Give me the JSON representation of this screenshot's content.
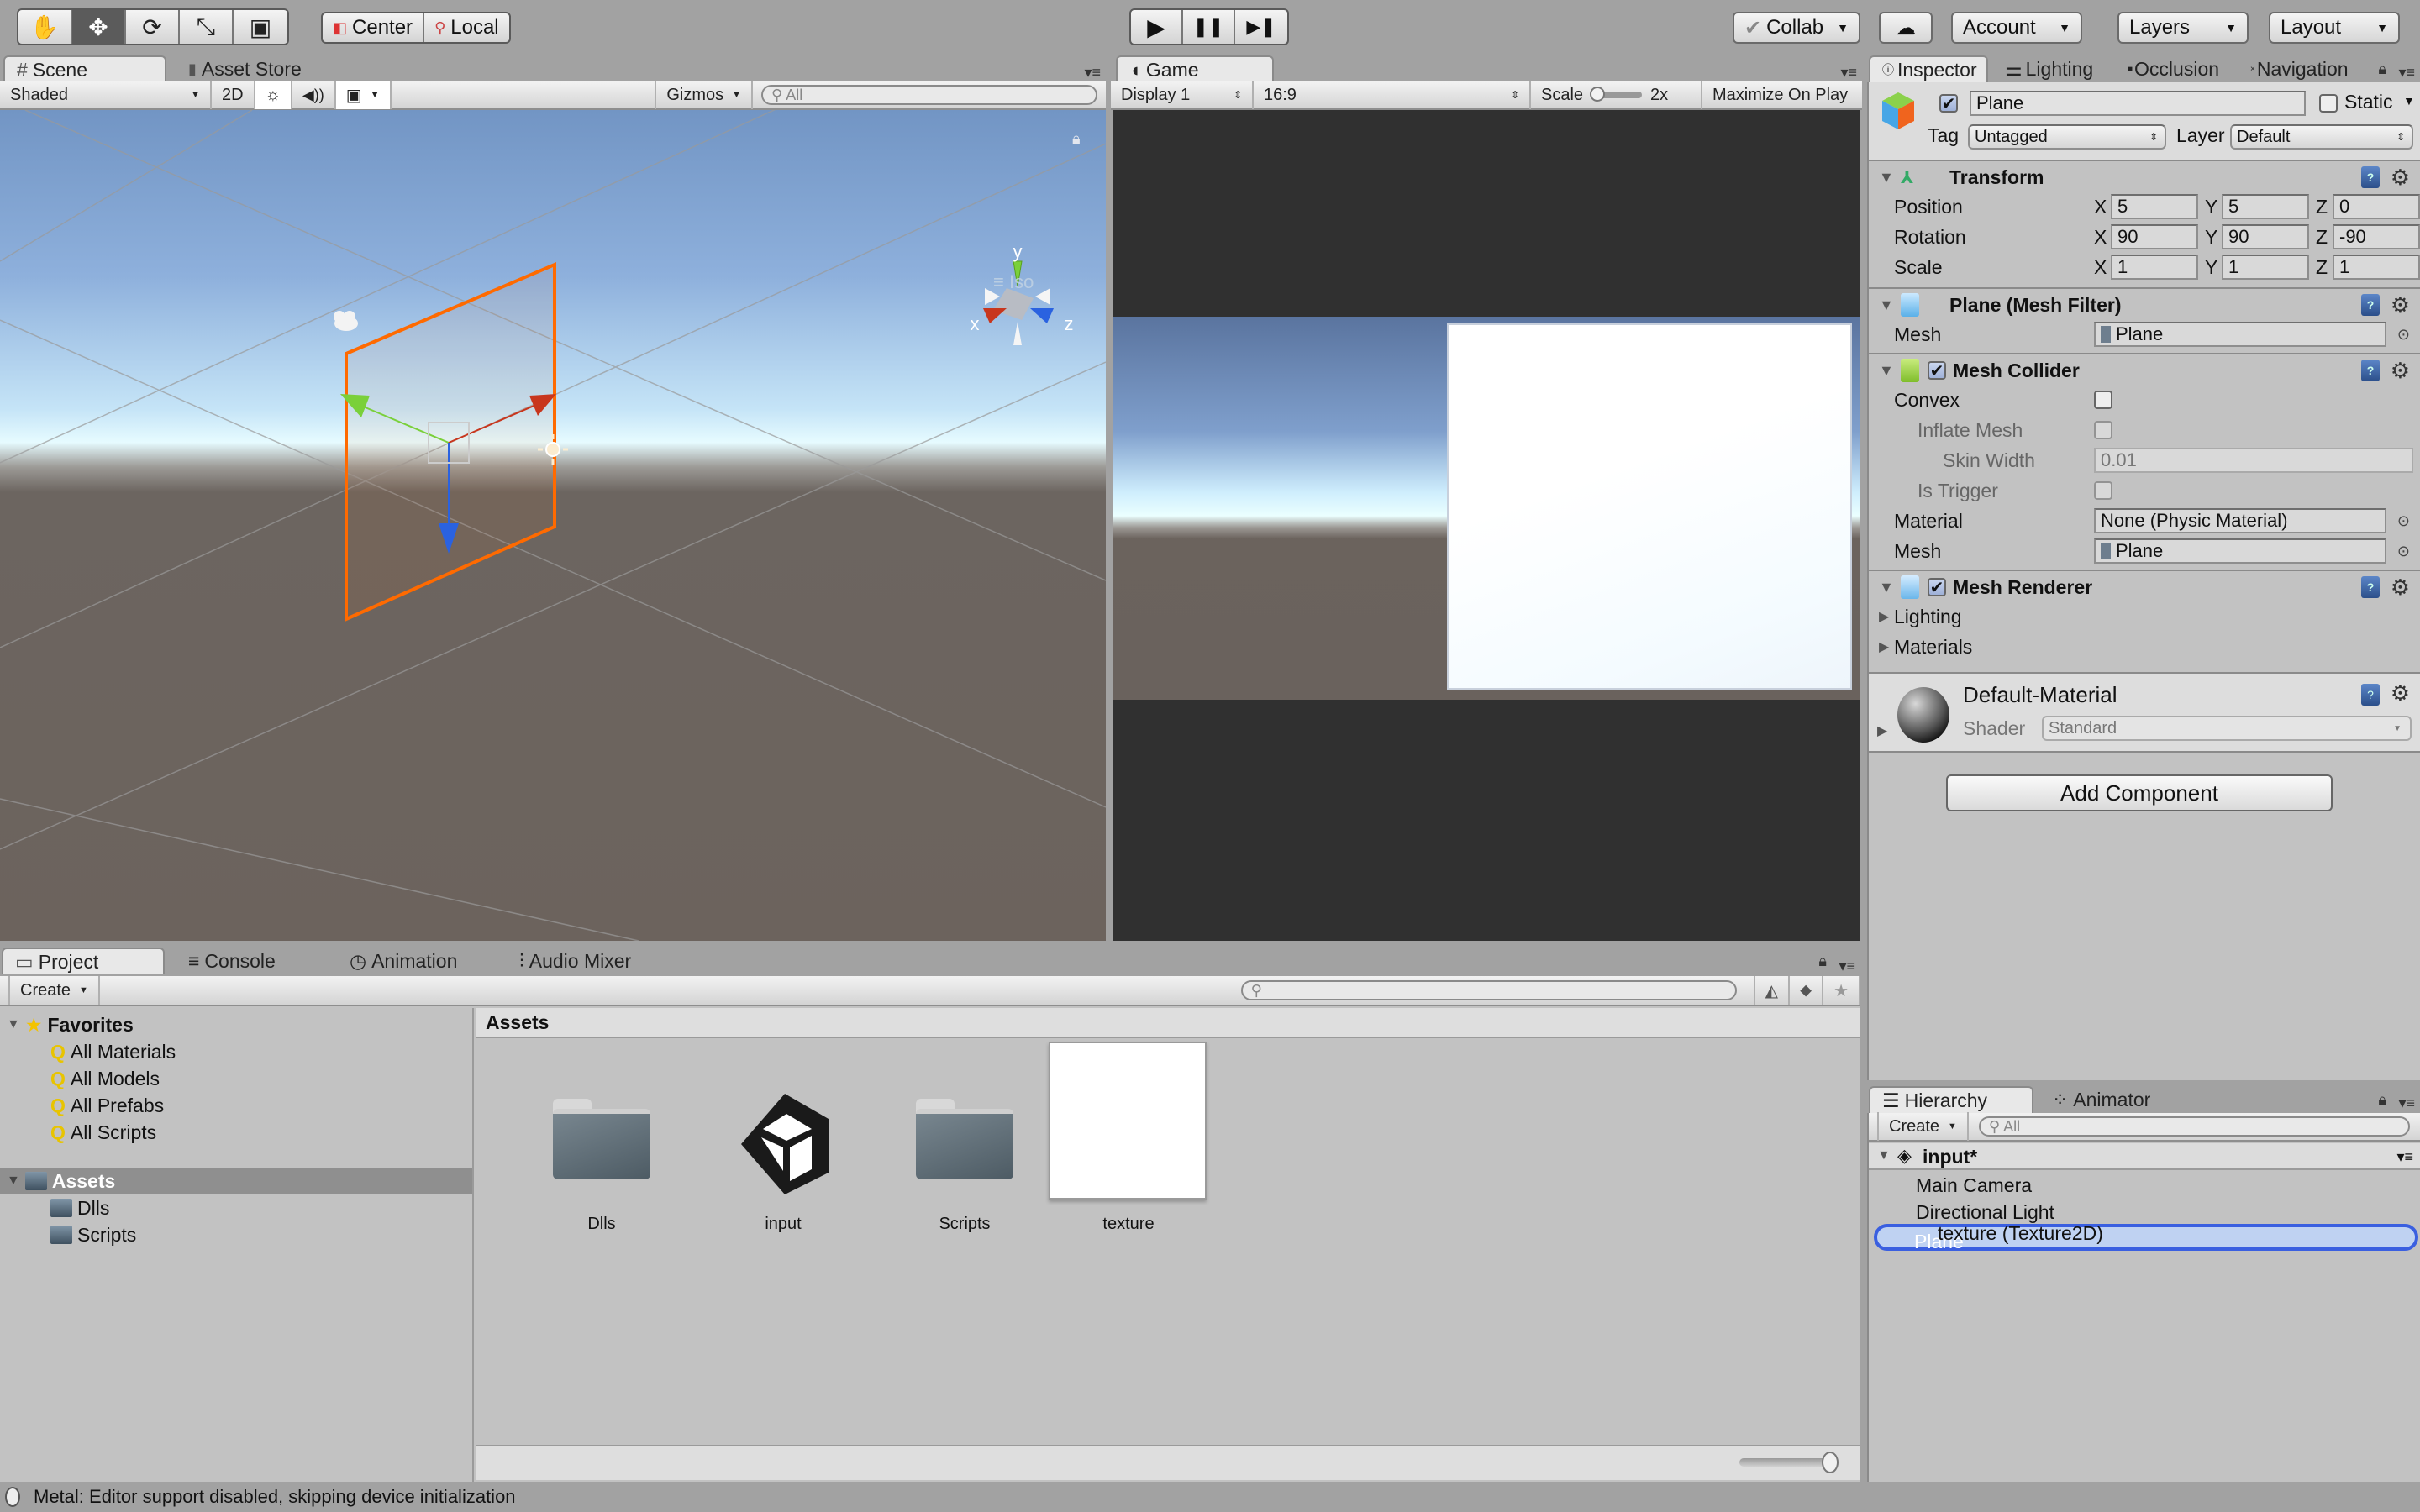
{
  "toolbar": {
    "transform_tools": [
      {
        "name": "hand-tool",
        "icon": "hand-icon",
        "glyph": "✋",
        "active": false
      },
      {
        "name": "move-tool",
        "icon": "move-arrows-icon",
        "glyph": "✥",
        "active": true
      },
      {
        "name": "rotate-tool",
        "icon": "rotate-icon",
        "glyph": "⟳",
        "active": false
      },
      {
        "name": "scale-tool",
        "icon": "scale-icon",
        "glyph": "⤡",
        "active": false
      },
      {
        "name": "rect-tool",
        "icon": "rect-transform-icon",
        "glyph": "▣",
        "active": false
      }
    ],
    "pivot_mode": "Center",
    "pivot_rotation": "Local",
    "play_glyphs": [
      "▶",
      "❚❚",
      "▶❚"
    ],
    "collab": "Collab",
    "cloud_glyph": "☁",
    "account": "Account",
    "layers": "Layers",
    "layout": "Layout"
  },
  "scene_panel": {
    "tabs": [
      {
        "label": "Scene",
        "glyph": "#",
        "active": true
      },
      {
        "label": "Asset Store",
        "glyph": "🛍",
        "active": false
      }
    ],
    "draw_mode": "Shaded",
    "mode_2d": "2D",
    "lighting_glyph": "☼",
    "audio_glyph": "🔊",
    "effects_glyph": "▣",
    "gizmos": "Gizmos",
    "search_placeholder": "All",
    "gizmo_axes": {
      "x": "x",
      "y": "y",
      "z": "z"
    },
    "projection": "Iso"
  },
  "game_panel": {
    "tab": "Game",
    "display": "Display 1",
    "aspect": "16:9",
    "scale_label": "Scale",
    "scale_value": "2x",
    "maximize": "Maximize On Play"
  },
  "inspector": {
    "tabs": [
      {
        "label": "Inspector",
        "active": true
      },
      {
        "label": "Lighting",
        "active": false
      },
      {
        "label": "Occlusion",
        "active": false
      },
      {
        "label": "Navigation",
        "active": false
      }
    ],
    "object_name": "Plane",
    "active": true,
    "static_label": "Static",
    "static": false,
    "tag_label": "Tag",
    "tag": "Untagged",
    "layer_label": "Layer",
    "layer": "Default",
    "transform": {
      "title": "Transform",
      "rows": [
        {
          "label": "Position",
          "x": "5",
          "y": "5",
          "z": "0"
        },
        {
          "label": "Rotation",
          "x": "90",
          "y": "90",
          "z": "-90"
        },
        {
          "label": "Scale",
          "x": "1",
          "y": "1",
          "z": "1"
        }
      ],
      "axis": {
        "x": "X",
        "y": "Y",
        "z": "Z"
      }
    },
    "mesh_filter": {
      "title": "Plane (Mesh Filter)",
      "mesh_label": "Mesh",
      "mesh": "Plane"
    },
    "mesh_collider": {
      "title": "Mesh Collider",
      "enabled": true,
      "convex_label": "Convex",
      "inflate_label": "Inflate Mesh",
      "skin_label": "Skin Width",
      "skin_value": "0.01",
      "trigger_label": "Is Trigger",
      "material_label": "Material",
      "material": "None (Physic Material)",
      "mesh_label": "Mesh",
      "mesh": "Plane"
    },
    "mesh_renderer": {
      "title": "Mesh Renderer",
      "enabled": true,
      "lighting": "Lighting",
      "materials": "Materials"
    },
    "material": {
      "name": "Default-Material",
      "shader_label": "Shader",
      "shader": "Standard"
    },
    "add_component": "Add Component"
  },
  "project_panel": {
    "tabs": [
      {
        "label": "Project",
        "glyph": "▭",
        "active": true
      },
      {
        "label": "Console",
        "glyph": "≡",
        "active": false
      },
      {
        "label": "Animation",
        "glyph": "◷",
        "active": false
      },
      {
        "label": "Audio Mixer",
        "glyph": "⫶",
        "active": false
      }
    ],
    "create": "Create",
    "favorites": {
      "label": "Favorites",
      "items": [
        "All Materials",
        "All Models",
        "All Prefabs",
        "All Scripts"
      ]
    },
    "assets_tree": {
      "label": "Assets",
      "children": [
        "Dlls",
        "Scripts"
      ]
    },
    "breadcrumb": "Assets",
    "assets": [
      {
        "name": "Dlls",
        "type": "folder"
      },
      {
        "name": "input",
        "type": "scene"
      },
      {
        "name": "Scripts",
        "type": "folder"
      },
      {
        "name": "texture",
        "type": "texture"
      }
    ]
  },
  "hierarchy": {
    "tabs": [
      {
        "label": "Hierarchy",
        "active": true
      },
      {
        "label": "Animator",
        "active": false
      }
    ],
    "create": "Create",
    "search_placeholder": "All",
    "scene": "input*",
    "items": [
      "Main Camera",
      "Directional Light",
      "Plane"
    ],
    "drag_label": "texture (Texture2D)"
  },
  "status": {
    "message": "Metal: Editor support disabled, skipping device initialization"
  },
  "colors": {
    "selection_orange": "#ff6a00",
    "accent_blue": "#3a5fe0",
    "axis_x": "#c8361d",
    "axis_y": "#7ad03a",
    "axis_z": "#2a62e0"
  }
}
